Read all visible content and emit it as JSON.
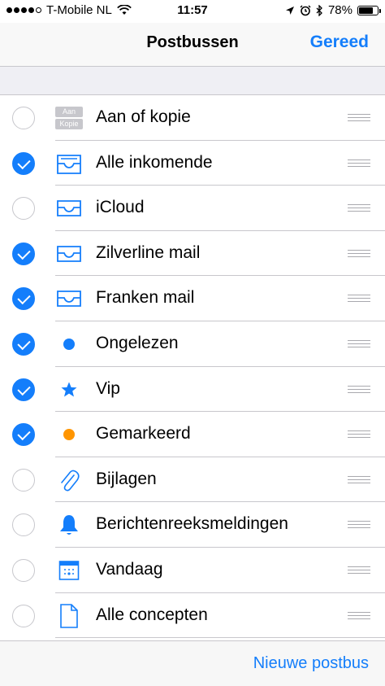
{
  "status_bar": {
    "carrier": "T-Mobile NL",
    "time": "11:57",
    "battery": "78%",
    "battery_level": 0.78
  },
  "nav": {
    "title": "Postbussen",
    "done_label": "Gereed"
  },
  "mailboxes": [
    {
      "label": "Aan of kopie",
      "checked": false,
      "icon": "aan-kopie-icon",
      "icon_text": [
        "Aan",
        "Kopie"
      ]
    },
    {
      "label": "Alle inkomende",
      "checked": true,
      "icon": "all-inbox-icon"
    },
    {
      "label": "iCloud",
      "checked": false,
      "icon": "inbox-icon"
    },
    {
      "label": "Zilverline mail",
      "checked": true,
      "icon": "inbox-icon"
    },
    {
      "label": "Franken mail",
      "checked": true,
      "icon": "inbox-icon"
    },
    {
      "label": "Ongelezen",
      "checked": true,
      "icon": "unread-dot-icon"
    },
    {
      "label": "Vip",
      "checked": true,
      "icon": "star-icon"
    },
    {
      "label": "Gemarkeerd",
      "checked": true,
      "icon": "flag-dot-icon"
    },
    {
      "label": "Bijlagen",
      "checked": false,
      "icon": "paperclip-icon"
    },
    {
      "label": "Berichtenreeksmeldingen",
      "checked": false,
      "icon": "bell-icon"
    },
    {
      "label": "Vandaag",
      "checked": false,
      "icon": "calendar-icon"
    },
    {
      "label": "Alle concepten",
      "checked": false,
      "icon": "document-icon"
    }
  ],
  "toolbar": {
    "new_mailbox_label": "Nieuwe postbus"
  },
  "colors": {
    "accent": "#147efb",
    "flag": "#ff9500",
    "separator": "#c8c7cc"
  }
}
